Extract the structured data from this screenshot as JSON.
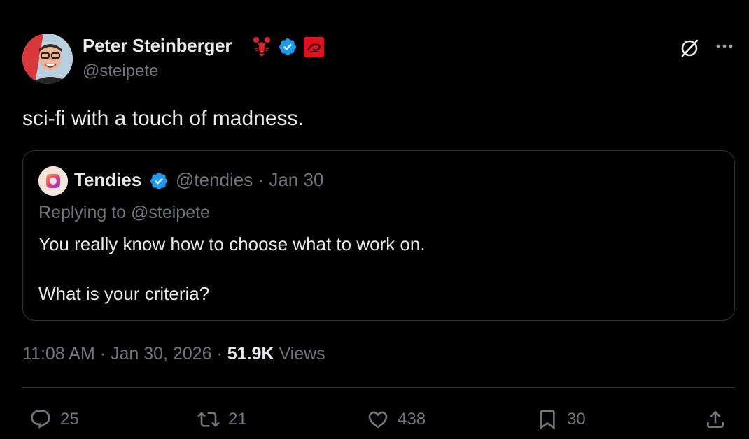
{
  "author": {
    "name": "Peter Steinberger",
    "handle": "@steipete",
    "name_emoji": "🦞",
    "verified": true
  },
  "tweet": {
    "text": "sci-fi with a touch of madness."
  },
  "quote": {
    "name": "Tendies",
    "handle_date": "@tendies · Jan 30",
    "replying_to": "Replying to @steipete",
    "line1": "You really know how to choose what to work on.",
    "line2": "What is your criteria?"
  },
  "meta": {
    "time_date": "11:08 AM · Jan 30, 2026 · ",
    "views_count": "51.9K",
    "views_label": " Views"
  },
  "actions": {
    "replies": "25",
    "reposts": "21",
    "likes": "438",
    "bookmarks": "30"
  },
  "colors": {
    "background": "#000000",
    "text": "#e7e9ea",
    "muted": "#71767b",
    "verified": "#1d9bf0",
    "border": "#2f3336"
  },
  "icons": [
    "grok-icon",
    "more-icon",
    "verified-badge-icon",
    "affiliate-badge-icon",
    "reply-icon",
    "repost-icon",
    "like-icon",
    "bookmark-icon",
    "share-icon"
  ]
}
